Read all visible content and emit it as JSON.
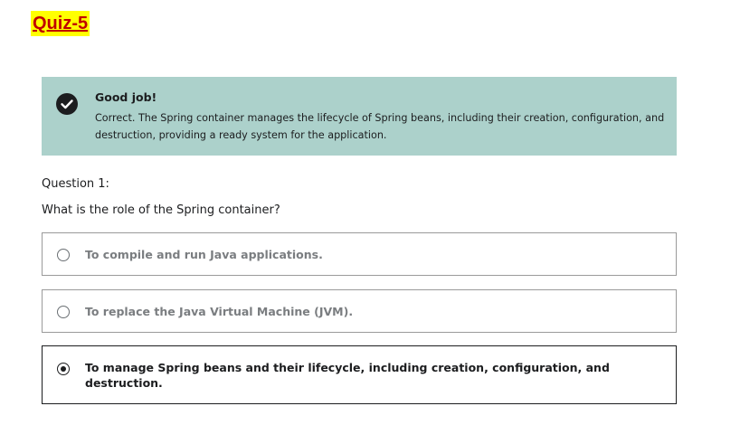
{
  "quiz": {
    "title": "Quiz-5",
    "title_color": "#c00000",
    "title_highlight": "#ffff00"
  },
  "feedback": {
    "icon": "check-circle-icon",
    "title": "Good job!",
    "text": "Correct. The Spring container manages the lifecycle of Spring beans, including their creation, configuration, and destruction, providing a ready system for the application.",
    "background": "#acd1cb"
  },
  "question": {
    "number": "Question 1:",
    "text": "What is the role of the Spring container?"
  },
  "options": [
    {
      "label": "To compile and run Java applications.",
      "selected": false
    },
    {
      "label": "To replace the Java Virtual Machine (JVM).",
      "selected": false
    },
    {
      "label": "To manage Spring beans and their lifecycle, including creation, configuration, and destruction.",
      "selected": true
    }
  ]
}
